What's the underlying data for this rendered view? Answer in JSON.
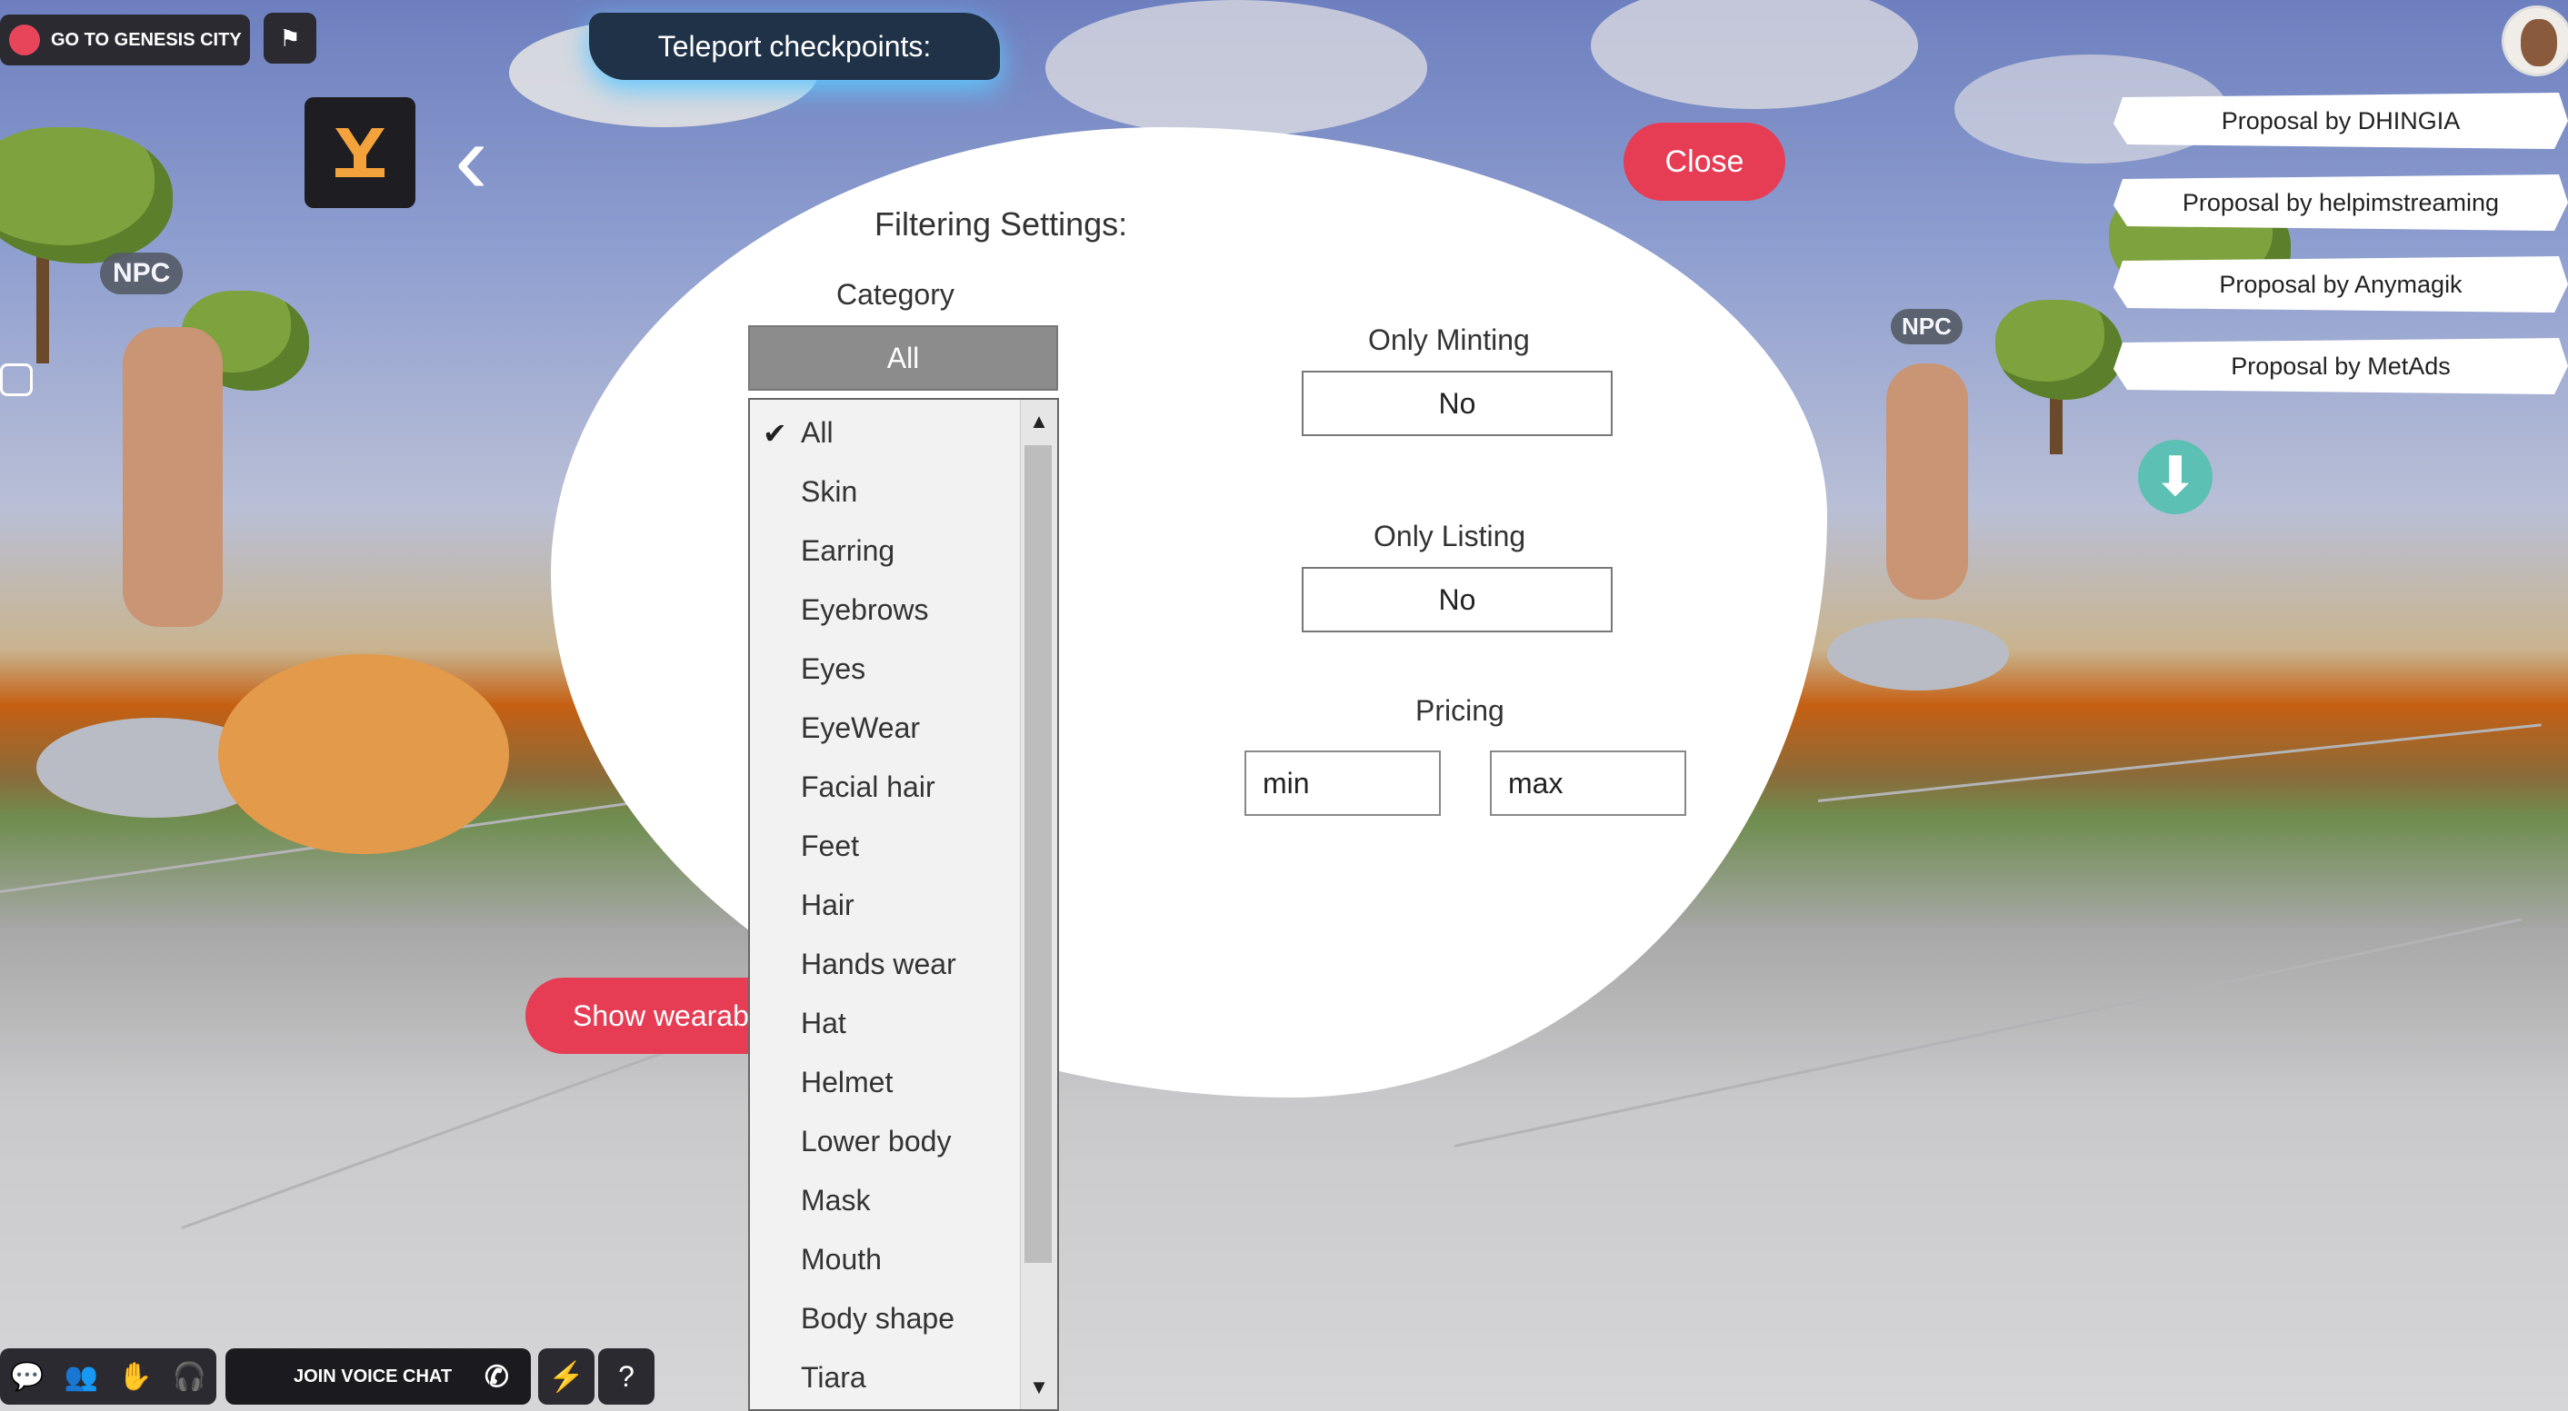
{
  "hud": {
    "genesis_label": "GO TO GENESIS CITY",
    "teleport_label": "Teleport checkpoints:",
    "npc_tag": "NPC",
    "voice_chat_label": "JOIN VOICE CHAT"
  },
  "proposals": [
    "Proposal by DHINGIA",
    "Proposal by helpimstreaming",
    "Proposal by Anymagik",
    "Proposal by MetAds"
  ],
  "panel": {
    "title": "Filtering Settings:",
    "close_label": "Close",
    "category_label": "Category",
    "category_selected": "All",
    "category_options": [
      "All",
      "Skin",
      "Earring",
      "Eyebrows",
      "Eyes",
      "EyeWear",
      "Facial hair",
      "Feet",
      "Hair",
      "Hands wear",
      "Hat",
      "Helmet",
      "Lower body",
      "Mask",
      "Mouth",
      "Body shape",
      "Tiara"
    ],
    "only_minting_label": "Only Minting",
    "only_minting_value": "No",
    "only_listing_label": "Only Listing",
    "only_listing_value": "No",
    "pricing_label": "Pricing",
    "min_value": "min",
    "max_value": "max",
    "show_wearables_label": "Show wearables"
  },
  "colors": {
    "accent_red": "#e63d55",
    "dark_ui": "#2a2a30",
    "teleport_bg": "#1f3248",
    "download_teal": "#5dc0b4"
  },
  "icons": [
    "flag-icon",
    "back-arrow-icon",
    "camera-icon",
    "download-icon",
    "chat-icon",
    "friends-icon",
    "emote-icon",
    "headphones-icon",
    "phone-icon",
    "bolt-icon",
    "help-icon",
    "check-icon"
  ]
}
